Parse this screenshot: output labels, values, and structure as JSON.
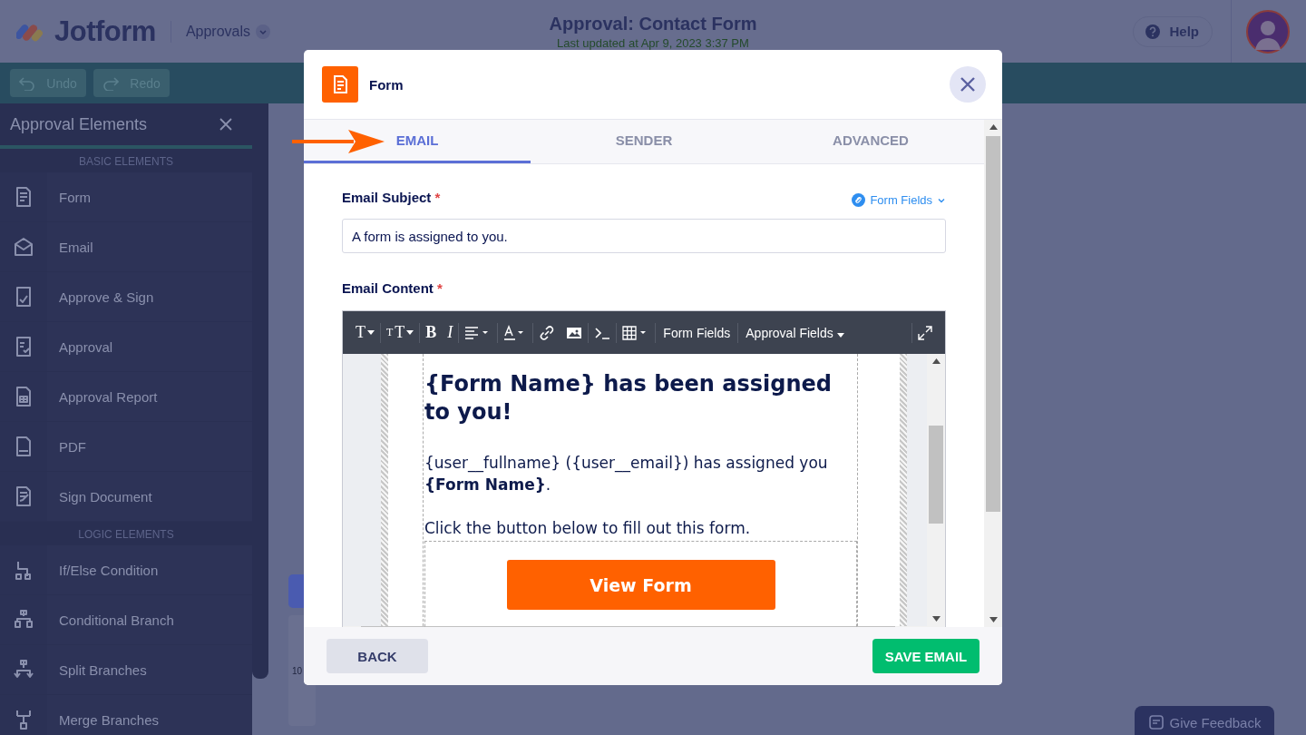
{
  "header": {
    "logo": "Jotform",
    "product": "Approvals",
    "title": "Approval: Contact Form",
    "subtitle": "Last updated at Apr 9, 2023 3:37 PM",
    "help": "Help"
  },
  "toolbar": {
    "undo": "Undo",
    "redo": "Redo"
  },
  "sidebar": {
    "title": "Approval Elements",
    "sections": [
      {
        "label": "BASIC ELEMENTS",
        "items": [
          "Form",
          "Email",
          "Approve & Sign",
          "Approval",
          "Approval Report",
          "PDF",
          "Sign Document"
        ]
      },
      {
        "label": "LOGIC ELEMENTS",
        "items": [
          "If/Else Condition",
          "Conditional Branch",
          "Split Branches",
          "Merge Branches"
        ]
      }
    ]
  },
  "canvas": {
    "zoom_level": "10"
  },
  "modal": {
    "title": "Form",
    "tabs": [
      {
        "label": "EMAIL",
        "selected": true
      },
      {
        "label": "SENDER",
        "selected": false
      },
      {
        "label": "ADVANCED",
        "selected": false
      }
    ],
    "subject": {
      "label": "Email Subject",
      "required_mark": "*",
      "link": "Form Fields",
      "value": "A form is assigned to you."
    },
    "content": {
      "label": "Email Content",
      "required_mark": "*",
      "format_buttons": {
        "style": "T",
        "size_small": "T",
        "size_big": "T",
        "bold": "B",
        "italic": "I"
      },
      "toolbar": [
        "Form Fields",
        "Approval Fields"
      ],
      "heading": "{Form Name} has been assigned to you!",
      "paragraphs": [
        "{user__fullname} ({user__email}) has assigned you **{Form Name}**.",
        "Click the button below to fill out this form."
      ],
      "button": "View Form"
    },
    "back": "BACK",
    "save": "SAVE EMAIL"
  },
  "feedback": "Give Feedback"
}
